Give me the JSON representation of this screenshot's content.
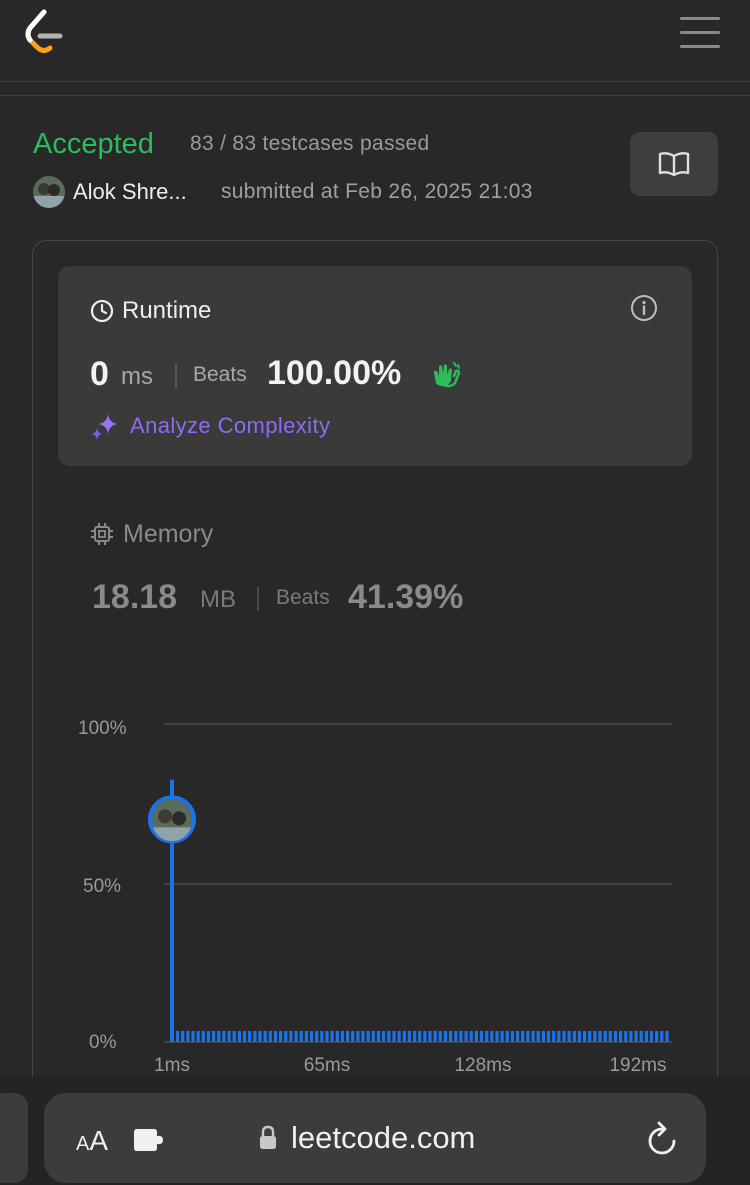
{
  "header": {
    "logo_icon": "leetcode-logo-icon",
    "menu_icon": "hamburger-menu-icon"
  },
  "submission": {
    "status": "Accepted",
    "status_color": "#2cbb5d",
    "testcases": "83 / 83 testcases passed",
    "username": "Alok Shre...",
    "submitted_at": "submitted at Feb 26, 2025 21:03",
    "solution_icon": "book-open-icon"
  },
  "runtime": {
    "title": "Runtime",
    "value": "0",
    "unit": "ms",
    "beats_label": "Beats",
    "beats_pct": "100.00%",
    "analyze_label": "Analyze Complexity",
    "accent_color": "#8f6bf5"
  },
  "memory": {
    "title": "Memory",
    "value": "18.18",
    "unit": "MB",
    "beats_label": "Beats",
    "beats_pct": "41.39%"
  },
  "chart_data": {
    "type": "bar",
    "y_ticks": [
      "100%",
      "50%",
      "0%"
    ],
    "x_ticks": [
      "1ms",
      "65ms",
      "128ms",
      "192ms"
    ],
    "ylim": [
      0,
      100
    ],
    "xlim": [
      1,
      192
    ],
    "bar_color": "#1a73e8",
    "grid": true,
    "bars": [
      {
        "x": 1,
        "y": 82.5
      },
      {
        "x": 2,
        "y": 3.5
      },
      {
        "x": 4,
        "y": 3.5
      },
      {
        "x": 6,
        "y": 3.5
      },
      {
        "x": 8,
        "y": 3.5
      },
      {
        "x": 10,
        "y": 3.5
      },
      {
        "x": 12,
        "y": 3.5
      },
      {
        "x": 14,
        "y": 3.5
      },
      {
        "x": 16,
        "y": 3.5
      },
      {
        "x": 18,
        "y": 3.5
      },
      {
        "x": 20,
        "y": 3.5
      },
      {
        "x": 22,
        "y": 3.5
      },
      {
        "x": 24,
        "y": 3.5
      },
      {
        "x": 26,
        "y": 3.5
      },
      {
        "x": 28,
        "y": 3.5
      },
      {
        "x": 30,
        "y": 3.5
      },
      {
        "x": 32,
        "y": 3.5
      },
      {
        "x": 34,
        "y": 3.5
      },
      {
        "x": 36,
        "y": 3.5
      },
      {
        "x": 38,
        "y": 3.5
      },
      {
        "x": 40,
        "y": 3.5
      },
      {
        "x": 42,
        "y": 3.5
      },
      {
        "x": 44,
        "y": 3.5
      },
      {
        "x": 46,
        "y": 3.5
      },
      {
        "x": 48,
        "y": 3.5
      },
      {
        "x": 50,
        "y": 3.5
      },
      {
        "x": 52,
        "y": 3.5
      },
      {
        "x": 54,
        "y": 3.5
      },
      {
        "x": 56,
        "y": 3.5
      },
      {
        "x": 58,
        "y": 3.5
      },
      {
        "x": 60,
        "y": 3.5
      },
      {
        "x": 62,
        "y": 3.5
      },
      {
        "x": 64,
        "y": 3.5
      },
      {
        "x": 66,
        "y": 3.5
      },
      {
        "x": 68,
        "y": 3.5
      },
      {
        "x": 70,
        "y": 3.5
      },
      {
        "x": 72,
        "y": 3.5
      },
      {
        "x": 74,
        "y": 3.5
      },
      {
        "x": 76,
        "y": 3.5
      },
      {
        "x": 78,
        "y": 3.5
      },
      {
        "x": 80,
        "y": 3.5
      },
      {
        "x": 82,
        "y": 3.5
      },
      {
        "x": 84,
        "y": 3.5
      },
      {
        "x": 86,
        "y": 3.5
      },
      {
        "x": 88,
        "y": 3.5
      },
      {
        "x": 90,
        "y": 3.5
      },
      {
        "x": 92,
        "y": 3.5
      },
      {
        "x": 94,
        "y": 3.5
      },
      {
        "x": 96,
        "y": 3.5
      },
      {
        "x": 98,
        "y": 3.5
      },
      {
        "x": 100,
        "y": 3.5
      },
      {
        "x": 102,
        "y": 3.5
      },
      {
        "x": 104,
        "y": 3.5
      },
      {
        "x": 106,
        "y": 3.5
      },
      {
        "x": 108,
        "y": 3.5
      },
      {
        "x": 110,
        "y": 3.5
      },
      {
        "x": 112,
        "y": 3.5
      },
      {
        "x": 114,
        "y": 3.5
      },
      {
        "x": 116,
        "y": 3.5
      },
      {
        "x": 118,
        "y": 3.5
      },
      {
        "x": 120,
        "y": 3.5
      },
      {
        "x": 122,
        "y": 3.5
      },
      {
        "x": 124,
        "y": 3.5
      },
      {
        "x": 126,
        "y": 3.5
      },
      {
        "x": 128,
        "y": 3.5
      },
      {
        "x": 130,
        "y": 3.5
      },
      {
        "x": 132,
        "y": 3.5
      },
      {
        "x": 134,
        "y": 3.5
      },
      {
        "x": 136,
        "y": 3.5
      },
      {
        "x": 138,
        "y": 3.5
      },
      {
        "x": 140,
        "y": 3.5
      },
      {
        "x": 142,
        "y": 3.5
      },
      {
        "x": 144,
        "y": 3.5
      },
      {
        "x": 146,
        "y": 3.5
      },
      {
        "x": 148,
        "y": 3.5
      },
      {
        "x": 150,
        "y": 3.5
      },
      {
        "x": 152,
        "y": 3.5
      },
      {
        "x": 154,
        "y": 3.5
      },
      {
        "x": 156,
        "y": 3.5
      },
      {
        "x": 158,
        "y": 3.5
      },
      {
        "x": 160,
        "y": 3.5
      },
      {
        "x": 162,
        "y": 3.5
      },
      {
        "x": 164,
        "y": 3.5
      },
      {
        "x": 166,
        "y": 3.5
      },
      {
        "x": 168,
        "y": 3.5
      },
      {
        "x": 170,
        "y": 3.5
      },
      {
        "x": 172,
        "y": 3.5
      },
      {
        "x": 174,
        "y": 3.5
      },
      {
        "x": 176,
        "y": 3.5
      },
      {
        "x": 178,
        "y": 3.5
      },
      {
        "x": 180,
        "y": 3.5
      },
      {
        "x": 182,
        "y": 3.5
      },
      {
        "x": 184,
        "y": 3.5
      },
      {
        "x": 186,
        "y": 3.5
      },
      {
        "x": 188,
        "y": 3.5
      },
      {
        "x": 190,
        "y": 3.5
      },
      {
        "x": 192,
        "y": 3.5
      }
    ],
    "user_marker": {
      "x": 1,
      "y": 70
    }
  },
  "browser": {
    "text_size_small": "A",
    "text_size_big": "A",
    "url": "leetcode.com",
    "extension_icon": "puzzle-icon",
    "lock_icon": "lock-icon",
    "reload_icon": "reload-icon"
  }
}
